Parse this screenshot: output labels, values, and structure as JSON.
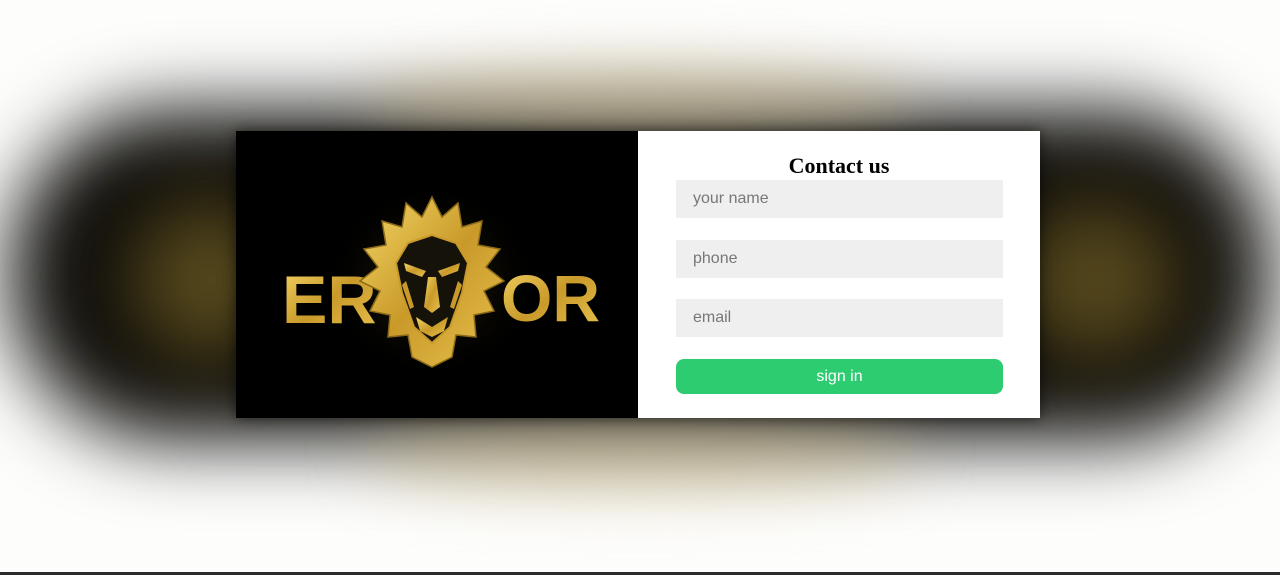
{
  "logo": {
    "left_text": "ER",
    "right_text": "OR",
    "gold_color": "#d9b23a",
    "icon": "lion-head-icon"
  },
  "form": {
    "title": "Contact us",
    "name_placeholder": "your name",
    "phone_placeholder": "phone",
    "email_placeholder": "email",
    "submit_label": "sign in",
    "submit_color": "#2ecc71"
  }
}
